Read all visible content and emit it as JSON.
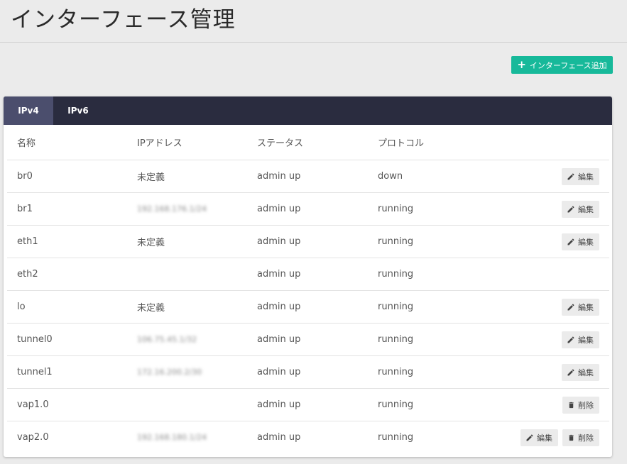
{
  "page": {
    "title": "インターフェース管理",
    "add_button_label": "インターフェース追加"
  },
  "tabs": [
    {
      "label": "IPv4",
      "active": true
    },
    {
      "label": "IPv6",
      "active": false
    }
  ],
  "table": {
    "columns": [
      "名称",
      "IPアドレス",
      "ステータス",
      "プロトコル"
    ],
    "edit_label": "編集",
    "delete_label": "削除",
    "rows": [
      {
        "name": "br0",
        "ip": "未定義",
        "status": "admin up",
        "protocol": "down"
      },
      {
        "name": "br1",
        "ip": "192.168.176.1/24",
        "status": "admin up",
        "protocol": "running"
      },
      {
        "name": "eth1",
        "ip": "未定義",
        "status": "admin up",
        "protocol": "running"
      },
      {
        "name": "eth2",
        "ip": "",
        "status": "admin up",
        "protocol": "running"
      },
      {
        "name": "lo",
        "ip": "未定義",
        "status": "admin up",
        "protocol": "running"
      },
      {
        "name": "tunnel0",
        "ip": "106.75.45.1/32",
        "status": "admin up",
        "protocol": "running"
      },
      {
        "name": "tunnel1",
        "ip": "172.16.200.2/30",
        "status": "admin up",
        "protocol": "running"
      },
      {
        "name": "vap1.0",
        "ip": "",
        "status": "admin up",
        "protocol": "running"
      },
      {
        "name": "vap2.0",
        "ip": "192.168.180.1/24",
        "status": "admin up",
        "protocol": "running"
      }
    ]
  },
  "colors": {
    "accent": "#17b99a",
    "tabbar": "#2a2c3f",
    "tab_active": "#4b4e6d"
  },
  "icons": {
    "add": "plus-icon",
    "edit": "pencil-icon",
    "delete": "trash-icon"
  }
}
